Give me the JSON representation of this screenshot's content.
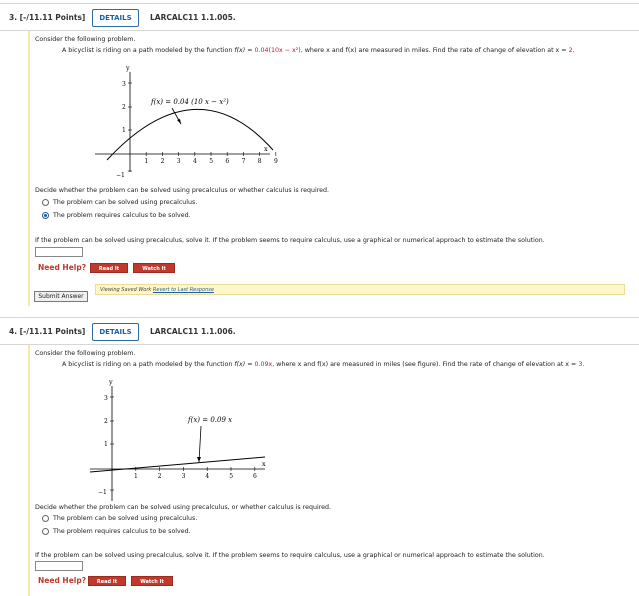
{
  "questions": [
    {
      "number_label": "3. [-/11.11 Points]",
      "details_label": "DETAILS",
      "code": "LARCALC11 1.1.005.",
      "intro": "Consider the following problem.",
      "problem_pre": "A bicyclist is riding on a path modeled by the function",
      "problem_fx": "f(x)",
      "problem_eq": "= ",
      "problem_func": "0.04(10x − x²),",
      "problem_mid": "where x and f(x) are measured in miles. Find the rate of change of elevation at x =",
      "problem_x": "2.",
      "graph_label": "f(x) = 0.04 (10 x − x²)",
      "decide": "Decide whether the problem can be solved using precalculus or whether calculus is required.",
      "options": [
        "The problem can be solved using precalculus.",
        "The problem requires calculus to be solved."
      ],
      "selected": 1,
      "solve": "If the problem can be solved using precalculus, solve it. If the problem seems to require calculus, use a graphical or numerical approach to estimate the solution.",
      "need_help": "Need Help?",
      "read_it": "Read It",
      "watch_it": "Watch It",
      "saved_work": "Viewing Saved Work",
      "revert": "Revert to Last Response",
      "submit": "Submit Answer"
    },
    {
      "number_label": "4. [-/11.11 Points]",
      "details_label": "DETAILS",
      "code": "LARCALC11 1.1.006.",
      "intro": "Consider the following problem.",
      "problem_pre": "A bicyclist is riding on a path modeled by the function",
      "problem_fx": "f(x)",
      "problem_eq": "= ",
      "problem_func": "0.09x,",
      "problem_mid": "where x and f(x) are measured in miles (see figure). Find the rate of change of elevation at x =",
      "problem_x": "3.",
      "graph_label": "f(x) = 0.09 x",
      "decide": "Decide whether the problem can be solved using precalculus, or whether calculus is required.",
      "options": [
        "The problem can be solved using precalculus.",
        "The problem requires calculus to be solved."
      ],
      "selected": -1,
      "solve": "If the problem can be solved using precalculus, solve it. If the problem seems to require calculus, use a graphical or numerical approach to estimate the solution.",
      "need_help": "Need Help?",
      "read_it": "Read It",
      "watch_it": "Watch It"
    }
  ],
  "graph1": {
    "y_label": "y",
    "x_label": "x",
    "y_ticks": [
      "3",
      "2",
      "1",
      "−1"
    ],
    "x_ticks": [
      "1",
      "2",
      "3",
      "4",
      "5",
      "6",
      "7",
      "8",
      "9"
    ]
  },
  "graph2": {
    "y_label": "y",
    "x_label": "x",
    "y_ticks": [
      "3",
      "2",
      "1",
      "−1"
    ],
    "x_ticks": [
      "1",
      "2",
      "3",
      "4",
      "5",
      "6"
    ]
  },
  "colors": {
    "accent_red": "#c8102e",
    "details_blue": "#1f5e9e",
    "help_red": "#c0392b"
  }
}
